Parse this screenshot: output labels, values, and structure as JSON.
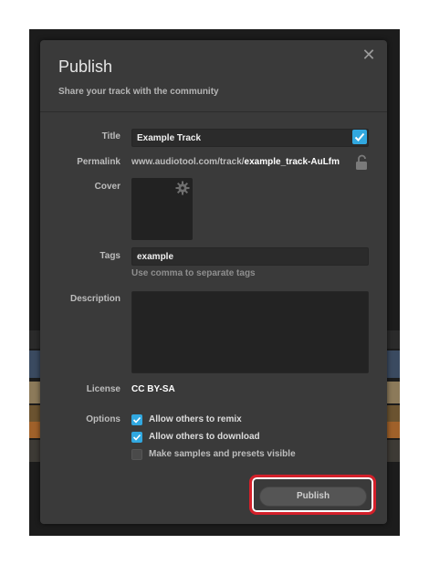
{
  "dialog": {
    "title": "Publish",
    "subtitle": "Share your track with the community",
    "close_symbol": "✕"
  },
  "form": {
    "title_label": "Title",
    "title_value": "Example Track",
    "title_checked": true,
    "permalink_label": "Permalink",
    "permalink_base": "www.audiotool.com/track/",
    "permalink_slug": "example_track-AuLfm",
    "cover_label": "Cover",
    "tags_label": "Tags",
    "tags_value": "example",
    "tags_hint": "Use comma to separate tags",
    "description_label": "Description",
    "description_value": "",
    "license_label": "License",
    "license_value": "CC BY-SA",
    "options_label": "Options",
    "options": [
      {
        "label": "Allow others to remix",
        "checked": true
      },
      {
        "label": "Allow others to download",
        "checked": true
      },
      {
        "label": "Make samples and presets visible",
        "checked": false
      }
    ]
  },
  "actions": {
    "publish_label": "Publish"
  },
  "icons": {
    "close": "close-icon",
    "check": "checkmark-icon",
    "lock": "unlock-icon",
    "cover_settings": "gear-icon"
  },
  "colors": {
    "accent": "#31a8e0",
    "highlight": "#d4202a",
    "dialog_bg": "#3a3a3a"
  }
}
